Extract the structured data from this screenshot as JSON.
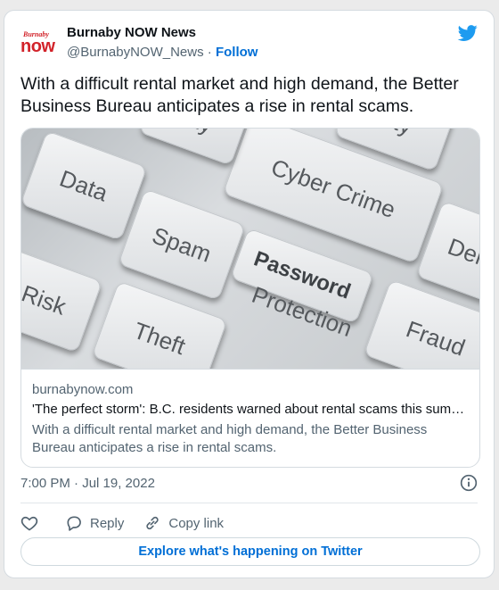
{
  "account": {
    "logo_small": "Burnaby",
    "logo_big": "now",
    "name": "Burnaby NOW News",
    "handle": "@BurnabyNOW_News",
    "separator": "·",
    "follow_label": "Follow"
  },
  "tweet": {
    "text": "With a difficult rental market and high demand, the Better Business Bureau anticipates a rise in rental scams."
  },
  "link_card": {
    "image_keys": [
      "Data",
      "Spam",
      "Cyber Crime",
      "Password",
      "Protection",
      "Risk",
      "Theft",
      "Fraud",
      "Dele",
      "nity",
      "ility"
    ],
    "domain": "burnabynow.com",
    "title": "'The perfect storm': B.C. residents warned about rental scams this sum…",
    "description": "With a difficult rental market and high demand, the Better Business Bureau anticipates a rise in rental scams."
  },
  "meta": {
    "timestamp": "7:00 PM · Jul 19, 2022"
  },
  "actions": {
    "reply_label": "Reply",
    "copy_link_label": "Copy link"
  },
  "explore_label": "Explore what's happening on Twitter",
  "colors": {
    "accent": "#006fd6",
    "twitter_blue": "#1d9bf0",
    "brand_red": "#d2232a"
  }
}
